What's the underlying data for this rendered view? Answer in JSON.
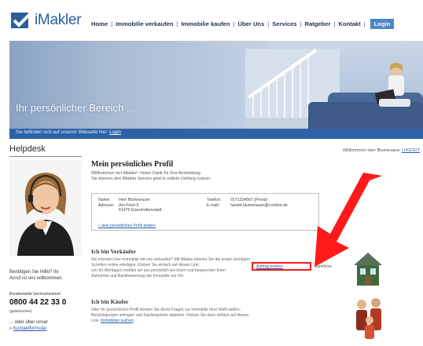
{
  "header": {
    "logo_text": "iMakler",
    "nav": [
      "Home",
      "Immobilie verkaufen",
      "Immobilie kaufen",
      "Über Uns",
      "Services",
      "Ratgeber",
      "Kontakt"
    ],
    "login_label": "Login"
  },
  "hero": {
    "title": "Ihr persönlicher Bereich ...",
    "subbar_text": "Sie befinden sich auf unserer Webseite hier:",
    "subbar_link": "Login"
  },
  "sidebar": {
    "title": "Helpdesk",
    "help_line1": "Benötigen Sie Hilfe? Ihr",
    "help_line2": "Anruf ist uns willkommen.",
    "hotline_line1": "Bundesweite Servicenummer:",
    "phone": "0800 44 22 33 0",
    "phone_note": "(gebührenfrei)",
    "or_text": "... oder über unser",
    "contact_link": "Kontaktformular"
  },
  "main": {
    "welcome_text": "Willkommen Herr Blumenauer",
    "welcome_link": "LOGOUT",
    "profile_title": "Mein persönliches Profil",
    "intro_line1": "Willkommen bei iMakler! Vielen Dank für Ihre Anmeldung.",
    "intro_line2": "Sie können den iMakler Service jetzt in vollem Umfang nutzen.",
    "info": {
      "name_label": "Name:",
      "name_value": "Herr Blumenauer",
      "address_label": "Adresse:",
      "address_line1": "Am Fried 5",
      "address_line2": "61476 Eisenhüttenstadt",
      "phone_label": "Telefon:",
      "phone_value": "0171234567 (Privat)",
      "email_label": "E-mail:",
      "email_value": "harald.blumenauer@t-online.de",
      "edit_link": "» dein persönliches Profil ändern"
    },
    "seller": {
      "title": "Ich bin Verkäufer",
      "line1": "Sie möchten Ihre Immobilie mit uns verkaufen? Mit iMakler können Sie die ersten wichtigen",
      "line2": "Schritten online erledigen. Klicken Sie einfach auf diesen Link:",
      "highlight_link": "Auftrag erteilen",
      "line3": "Sämtliche",
      "line4": "von Ihr Werttagen melden wir uns persönlich bei Ihnen und besprechen Ihren",
      "line5": "Aufnahme und Bankbewertung der Immobilie vor Ort."
    },
    "buyer": {
      "title": "Ich bin Käufer",
      "line1": "Über Ihr persönliches Profil können Sie direkt Fragen zur Immobilie Ihrer Wahl stellen,",
      "line2": "Besichtigungen anfragen und Kaufangebote abgeben. Klicken Sie dazu einfach auf diesen",
      "line3": "Link:",
      "link": "Immobilien suchen"
    }
  },
  "colors": {
    "brand_blue": "#2a5e9c",
    "subbar": "#2d62a6",
    "highlight_red": "#ff1a1a",
    "arrow_red": "#ff1a1a"
  }
}
